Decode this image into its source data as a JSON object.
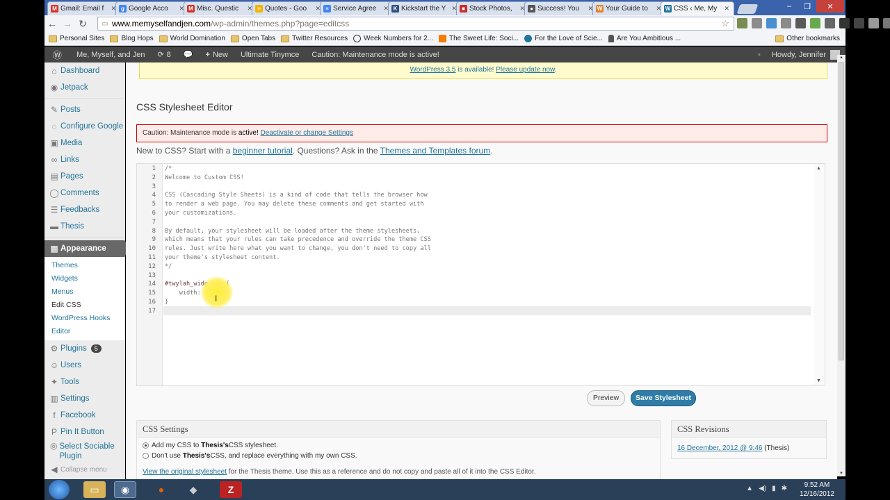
{
  "browser": {
    "tabs": [
      {
        "label": "Gmail: Email f",
        "fav": "M",
        "color": "#d93025"
      },
      {
        "label": "Google Acco",
        "fav": "g",
        "color": "#4285f4"
      },
      {
        "label": "Misc. Questic",
        "fav": "M",
        "color": "#d93025"
      },
      {
        "label": "Quotes - Goo",
        "fav": "≡",
        "color": "#f4b400"
      },
      {
        "label": "Service Agree",
        "fav": "≡",
        "color": "#4285f4"
      },
      {
        "label": "Kickstart the Y",
        "fav": "K",
        "color": "#2b4d80"
      },
      {
        "label": "Stock Photos,",
        "fav": "■",
        "color": "#c92b2b"
      },
      {
        "label": "Success! You",
        "fav": "●",
        "color": "#555555"
      },
      {
        "label": "Your Guide to",
        "fav": "W",
        "color": "#e0832b"
      },
      {
        "label": "CSS ‹ Me, My",
        "fav": "W",
        "color": "#21759b"
      }
    ],
    "url_host": "www.memyselfandjen.com",
    "url_path": "/wp-admin/themes.php?page=editcss",
    "bookmarks": [
      {
        "label": "Personal Sites",
        "type": "folder"
      },
      {
        "label": "Blog Hops",
        "type": "folder"
      },
      {
        "label": "World Domination",
        "type": "folder"
      },
      {
        "label": "Open Tabs",
        "type": "folder"
      },
      {
        "label": "Twitter Resources",
        "type": "folder"
      },
      {
        "label": "Week Numbers for 2...",
        "type": "clock"
      },
      {
        "label": "The Sweet Life: Soci...",
        "type": "blogger"
      },
      {
        "label": "For the Love of Scie...",
        "type": "wp"
      },
      {
        "label": "Are You Ambitious ...",
        "type": "person"
      }
    ],
    "other_bookmarks": "Other bookmarks"
  },
  "adminbar": {
    "site_name": "Me, Myself, and Jen",
    "updates_count": "8",
    "new_label": "New",
    "plugin_label": "Ultimate Tinymce",
    "maintenance_notice": "Caution: Maintenance mode is active!",
    "howdy": "Howdy, Jennifer"
  },
  "sidebar": {
    "items": [
      {
        "label": "Dashboard",
        "icon": "⌂"
      },
      {
        "label": "Jetpack",
        "icon": "◉"
      },
      {
        "label": "Posts",
        "icon": "✎"
      },
      {
        "label": "Configure Google",
        "icon": "◌"
      },
      {
        "label": "Media",
        "icon": "▣"
      },
      {
        "label": "Links",
        "icon": "∞"
      },
      {
        "label": "Pages",
        "icon": "▤"
      },
      {
        "label": "Comments",
        "icon": "◯"
      },
      {
        "label": "Feedbacks",
        "icon": "☰"
      },
      {
        "label": "Thesis",
        "icon": "▬"
      },
      {
        "label": "Appearance",
        "icon": "▦"
      },
      {
        "label": "Plugins",
        "icon": "⚙"
      },
      {
        "label": "Users",
        "icon": "☺"
      },
      {
        "label": "Tools",
        "icon": "✦"
      },
      {
        "label": "Settings",
        "icon": "▥"
      },
      {
        "label": "Facebook",
        "icon": "f"
      },
      {
        "label": "Pin It Button",
        "icon": "P"
      },
      {
        "label": "Select Sociable Plugin",
        "icon": "◎"
      }
    ],
    "appearance_sub": [
      "Themes",
      "Widgets",
      "Menus",
      "Edit CSS",
      "WordPress Hooks",
      "Editor"
    ],
    "plugins_badge": "5",
    "collapse": "Collapse menu"
  },
  "notices": {
    "update_version": "WordPress 3.5",
    "update_middle": " is available! ",
    "update_link": "Please update now",
    "update_end": ".",
    "maint_text": "Caution: Maintenance mode is ",
    "maint_bold": "active!",
    "maint_link": "Deactivate or change Settings"
  },
  "page": {
    "title": "CSS Stylesheet Editor",
    "intro_1": "New to CSS? Start with a ",
    "intro_link1": "beginner tutorial",
    "intro_2": ". Questions? Ask in the ",
    "intro_link2": "Themes and Templates forum",
    "intro_3": "."
  },
  "editor": {
    "lines": [
      "/*",
      "Welcome to Custom CSS!",
      "",
      "CSS (Cascading Style Sheets) is a kind of code that tells the browser how",
      "to render a web page. You may delete these comments and get started with",
      "your customizations.",
      "",
      "By default, your stylesheet will be loaded after the theme stylesheets,",
      "which means that your rules can take precedence and override the theme CSS",
      "rules. Just write here what you want to change, you don't need to copy all",
      "your theme's stylesheet content.",
      "*/",
      "",
      "#twylah_widget-2 {",
      "    width: 250px;",
      "}",
      ""
    ]
  },
  "buttons": {
    "preview": "Preview",
    "save": "Save Stylesheet"
  },
  "css_settings": {
    "title": "CSS Settings",
    "opt1_a": "Add my CSS to ",
    "opt1_b": "Thesis's",
    "opt1_c": " CSS stylesheet.",
    "opt2_a": "Don't use ",
    "opt2_b": "Thesis's",
    "opt2_c": " CSS, and replace everything with my own CSS.",
    "orig_link": "View the original stylesheet",
    "orig_text": " for the Thesis theme. Use this as a reference and do not copy and paste all of it into the CSS Editor."
  },
  "css_revisions": {
    "title": "CSS Revisions",
    "link": "16 December, 2012 @ 9:46",
    "suffix": " (Thesis)"
  },
  "taskbar": {
    "time": "9:52 AM",
    "date": "12/16/2012"
  }
}
